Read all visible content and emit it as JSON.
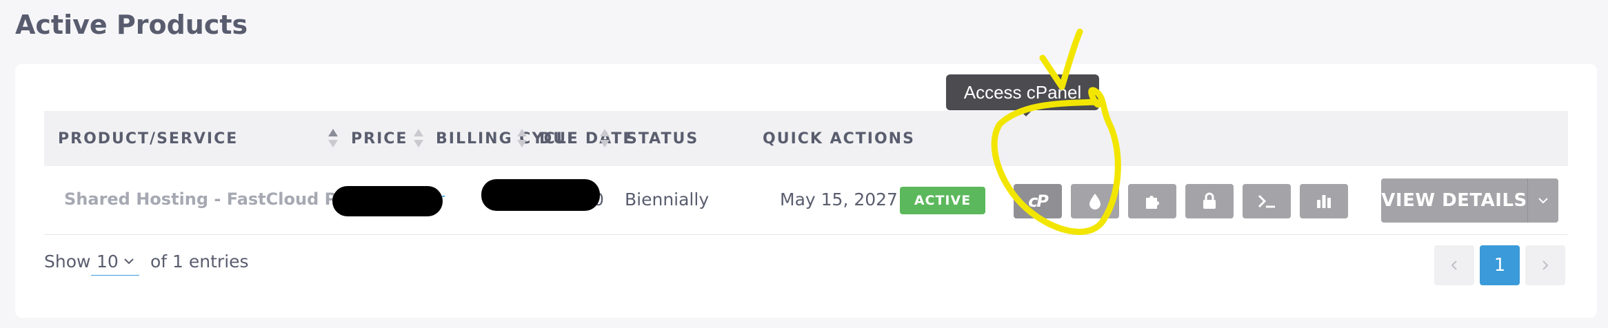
{
  "page": {
    "title": "Active Products"
  },
  "table": {
    "headers": {
      "product": "PRODUCT/SERVICE",
      "price": "PRICE",
      "billing": "BILLING CYCLE",
      "due": "DUE DATE",
      "status": "STATUS",
      "quick": "QUICK ACTIONS"
    },
    "rows": [
      {
        "product": "Shared Hosting - FastCloud Plus",
        "product_link_tail": "r",
        "price_tail": "0",
        "billing_cycle": "Biennially",
        "due_date": "May 15, 2027",
        "status": "ACTIVE"
      }
    ]
  },
  "quick_actions": [
    {
      "name": "cpanel-icon"
    },
    {
      "name": "droplet-icon"
    },
    {
      "name": "puzzle-icon"
    },
    {
      "name": "lock-icon"
    },
    {
      "name": "terminal-icon"
    },
    {
      "name": "bar-chart-icon"
    }
  ],
  "tooltip": {
    "text": "Access cPanel"
  },
  "view_details": {
    "label": "VIEW DETAILS"
  },
  "footer": {
    "show_label": "Show",
    "per_page": "10",
    "entries_label": "of 1 entries"
  },
  "pagination": {
    "current": "1"
  },
  "colors": {
    "status_active": "#5cb85c",
    "accent": "#3b9ad9",
    "action_button": "#a4a4a8",
    "annotation": "#f2e600"
  }
}
